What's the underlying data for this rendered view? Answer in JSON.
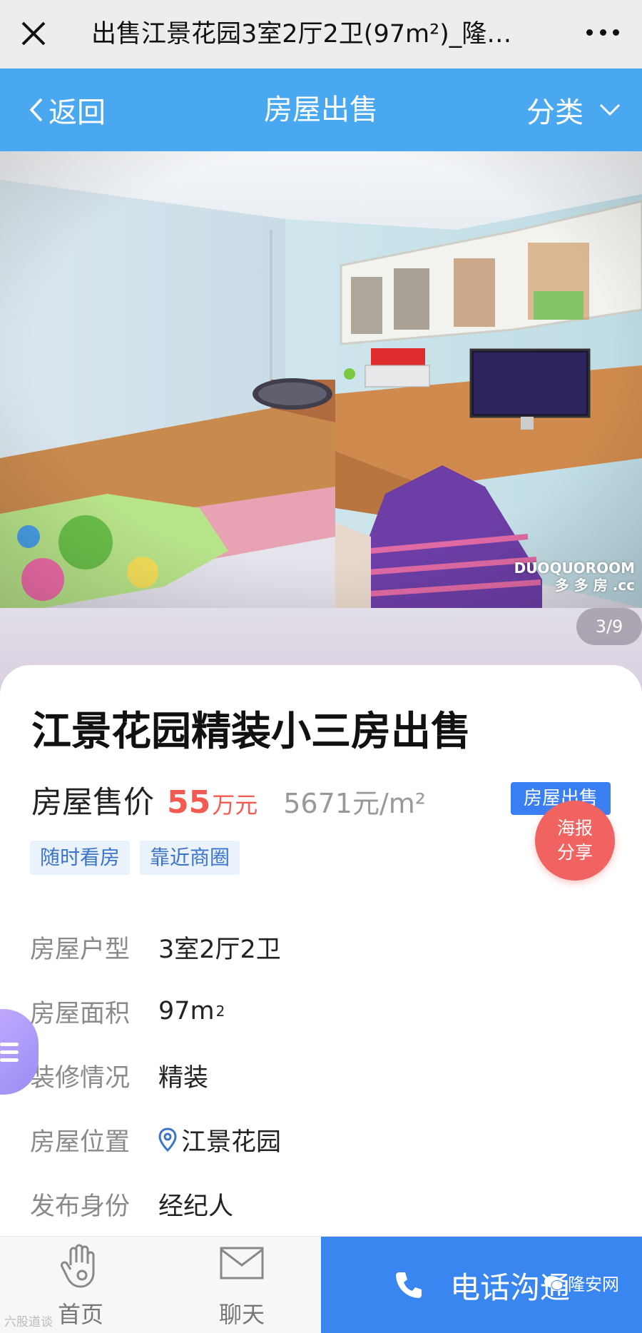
{
  "webview": {
    "title": "出售江景花园3室2厅2卫(97m²)_隆…",
    "close_icon": "close-icon",
    "more_icon": "more-icon"
  },
  "nav": {
    "back_label": "返回",
    "title": "房屋出售",
    "category_label": "分类"
  },
  "gallery": {
    "counter": "3/9",
    "watermark_line1": "DUOQUOROOM",
    "watermark_line2": "多 多 房 .cc"
  },
  "listing": {
    "title": "江景花园精装小三房出售",
    "price_label": "房屋售价",
    "price_value": "55",
    "price_unit": "万元",
    "unit_price": "5671元/m²",
    "type_badge": "房屋出售",
    "poster_share_line1": "海报",
    "poster_share_line2": "分享",
    "tags": [
      "随时看房",
      "靠近商圈"
    ]
  },
  "details": [
    {
      "key": "房屋户型",
      "value": "3室2厅2卫"
    },
    {
      "key": "房屋面积",
      "value": "97m",
      "sup": "2"
    },
    {
      "key": "装修情况",
      "value": "精装"
    },
    {
      "key": "房屋位置",
      "value": "江景花园",
      "icon": "location-pin-icon"
    },
    {
      "key": "发布身份",
      "value": "经纪人"
    }
  ],
  "bottom_bar": {
    "home_label": "首页",
    "chat_label": "聊天",
    "call_label": "电话沟通",
    "footer_watermark": "六股道谈",
    "brand": "隆安网"
  },
  "colors": {
    "nav_blue": "#4aa8f0",
    "price_red": "#f35b52",
    "call_blue": "#3a86f0",
    "tag_blue": "#3b74c9"
  }
}
